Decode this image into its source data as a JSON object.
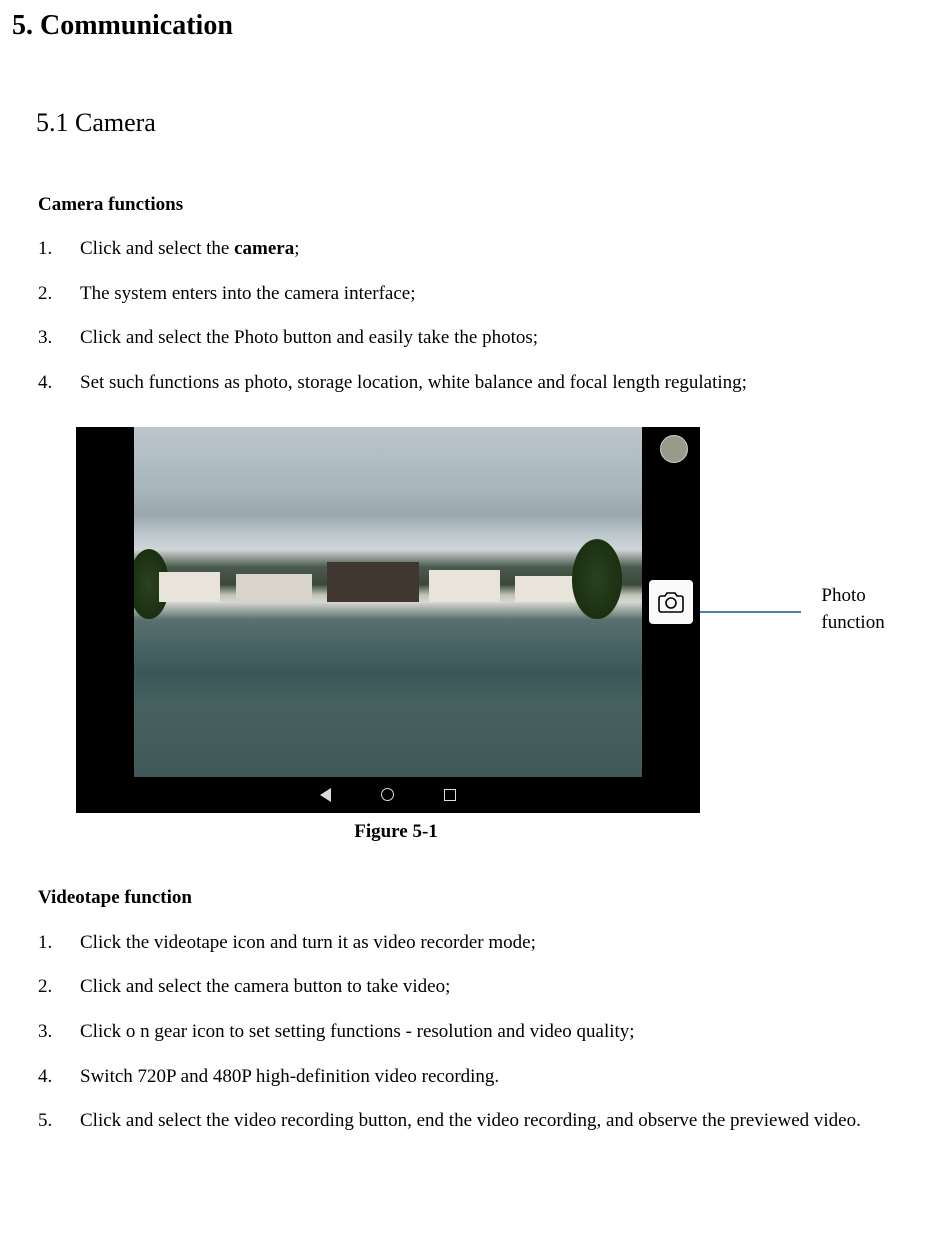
{
  "section": {
    "number": "5.",
    "title": "Communication"
  },
  "subsection": {
    "number": "5.1",
    "title": "Camera"
  },
  "camera_functions": {
    "heading": "Camera functions",
    "items": [
      {
        "n": "1.",
        "pre": "Click and select the ",
        "bold": "camera",
        "post": ";"
      },
      {
        "n": "2.",
        "pre": "The system enters into the camera interface;",
        "bold": "",
        "post": ""
      },
      {
        "n": "3.",
        "pre": "Click and select the Photo button and easily take the photos;",
        "bold": "",
        "post": ""
      },
      {
        "n": "4.",
        "pre": "Set such functions as photo, storage location, white balance and focal length regulating;",
        "bold": "",
        "post": ""
      }
    ]
  },
  "figure": {
    "caption": "Figure 5-1",
    "callout": "Photo function"
  },
  "videotape": {
    "heading": "Videotape function",
    "items": [
      {
        "n": "1.",
        "text": "Click the videotape icon and turn it as video recorder mode;"
      },
      {
        "n": "2.",
        "text": "Click and select the camera button to take video;"
      },
      {
        "n": "3.",
        "text": "Click o n gear icon to set setting functions - resolution and video quality;"
      },
      {
        "n": "4.",
        "text": "Switch 720P and 480P high-definition video recording."
      },
      {
        "n": "5.",
        "text": "Click and select the video recording button, end the video recording, and observe the previewed video."
      }
    ]
  }
}
